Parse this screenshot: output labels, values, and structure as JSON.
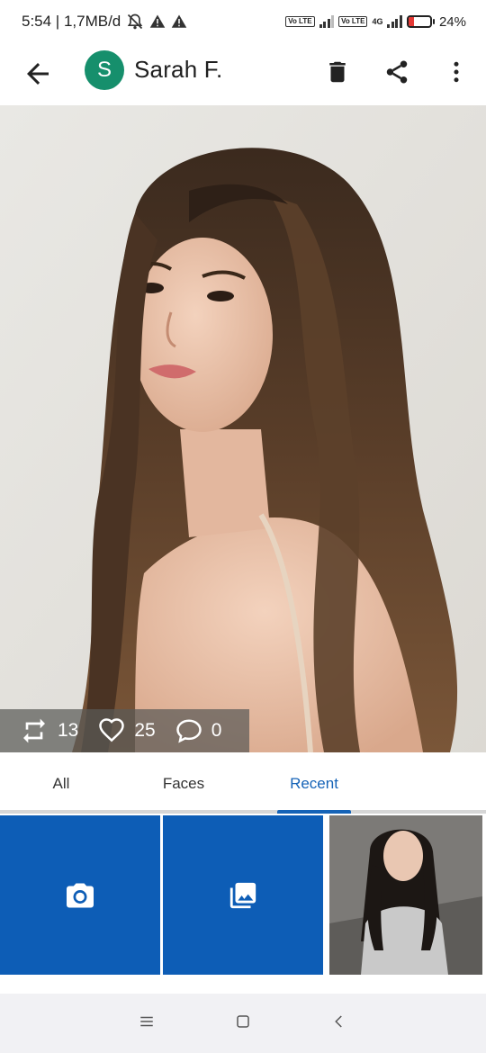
{
  "status_bar": {
    "time_speed": "5:54 | 1,7MB/d",
    "volte1": "Vo LTE",
    "volte2": "Vo LTE",
    "network": "4G",
    "battery_level": 0.24,
    "battery_text": "24%"
  },
  "app_bar": {
    "avatar_letter": "S",
    "title": "Sarah F.",
    "icons": [
      "back-arrow-icon",
      "trash-icon",
      "share-icon",
      "more-vert-icon"
    ]
  },
  "photo_stats": {
    "shares": "13",
    "likes": "25",
    "comments": "0"
  },
  "tabs": [
    {
      "label": "All",
      "active": false
    },
    {
      "label": "Faces",
      "active": false
    },
    {
      "label": "Recent",
      "active": true
    }
  ],
  "grid_tiles": [
    "camera-icon",
    "gallery-icon",
    "photo-thumbnail"
  ],
  "colors": {
    "accent": "#1563b7",
    "tile_blue": "#0d5db6",
    "avatar_green": "#168f6c",
    "battery_red": "#e53935"
  }
}
